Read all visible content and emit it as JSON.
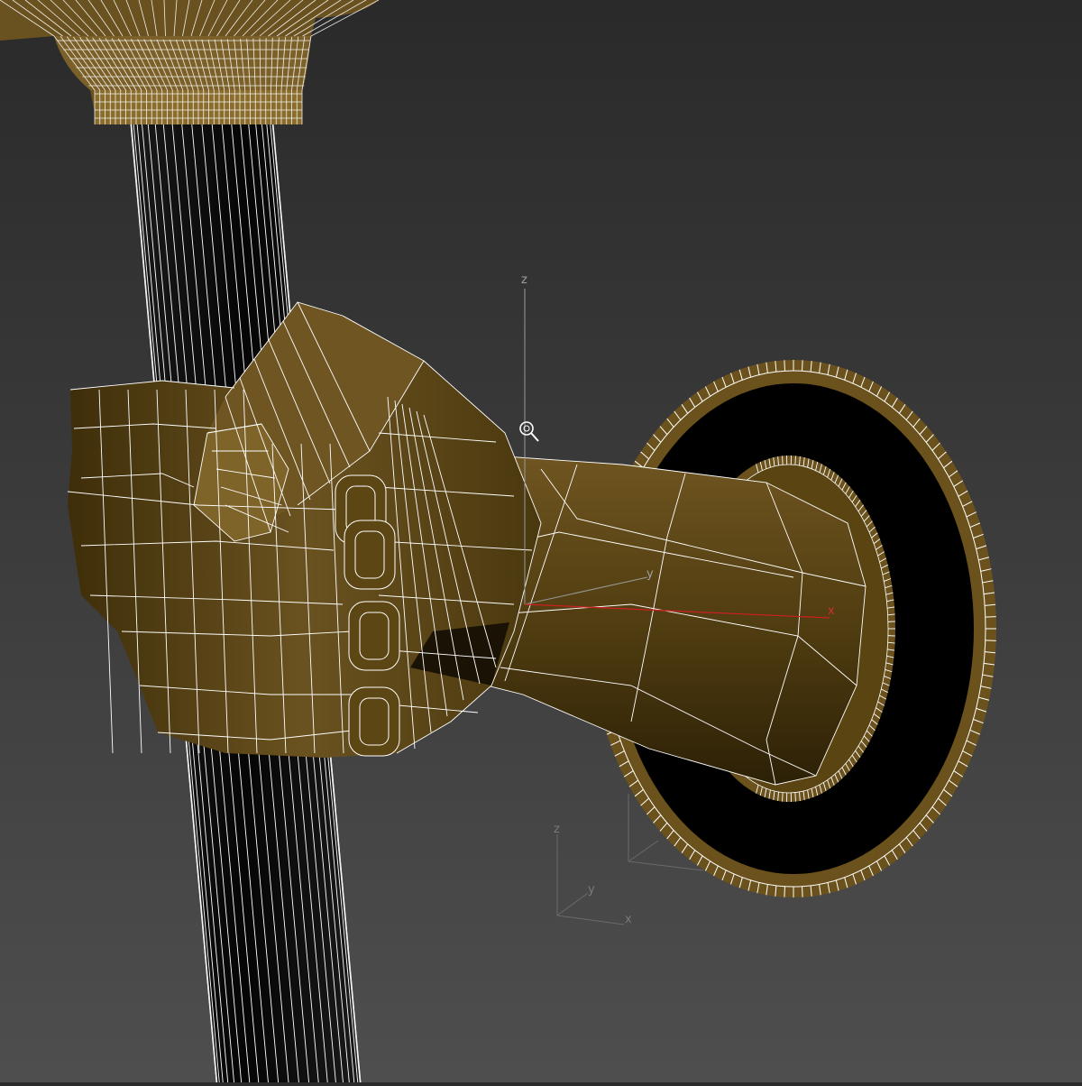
{
  "viewport": {
    "background_top": "#2a2a2a",
    "background_bottom": "#4e4e4e",
    "mesh_fill": "#5a4413",
    "mesh_fill_dark": "#3a2a08",
    "mesh_fill_light": "#7a5f22",
    "wire_color": "#ffffff",
    "shaft_fill": "#0d0d0d",
    "disc_inner_fill": "#000000"
  },
  "gizmo": {
    "z_label": "z",
    "y_label": "y",
    "x_label": "x",
    "axis_color": "#9a9a9a",
    "x_axis_color": "#cc2020",
    "cursor_icon": "zoom-cursor-icon"
  },
  "world_axes": {
    "z_label": "z",
    "y_label": "y",
    "x_label": "x",
    "axis_color": "#6a6a6a"
  }
}
